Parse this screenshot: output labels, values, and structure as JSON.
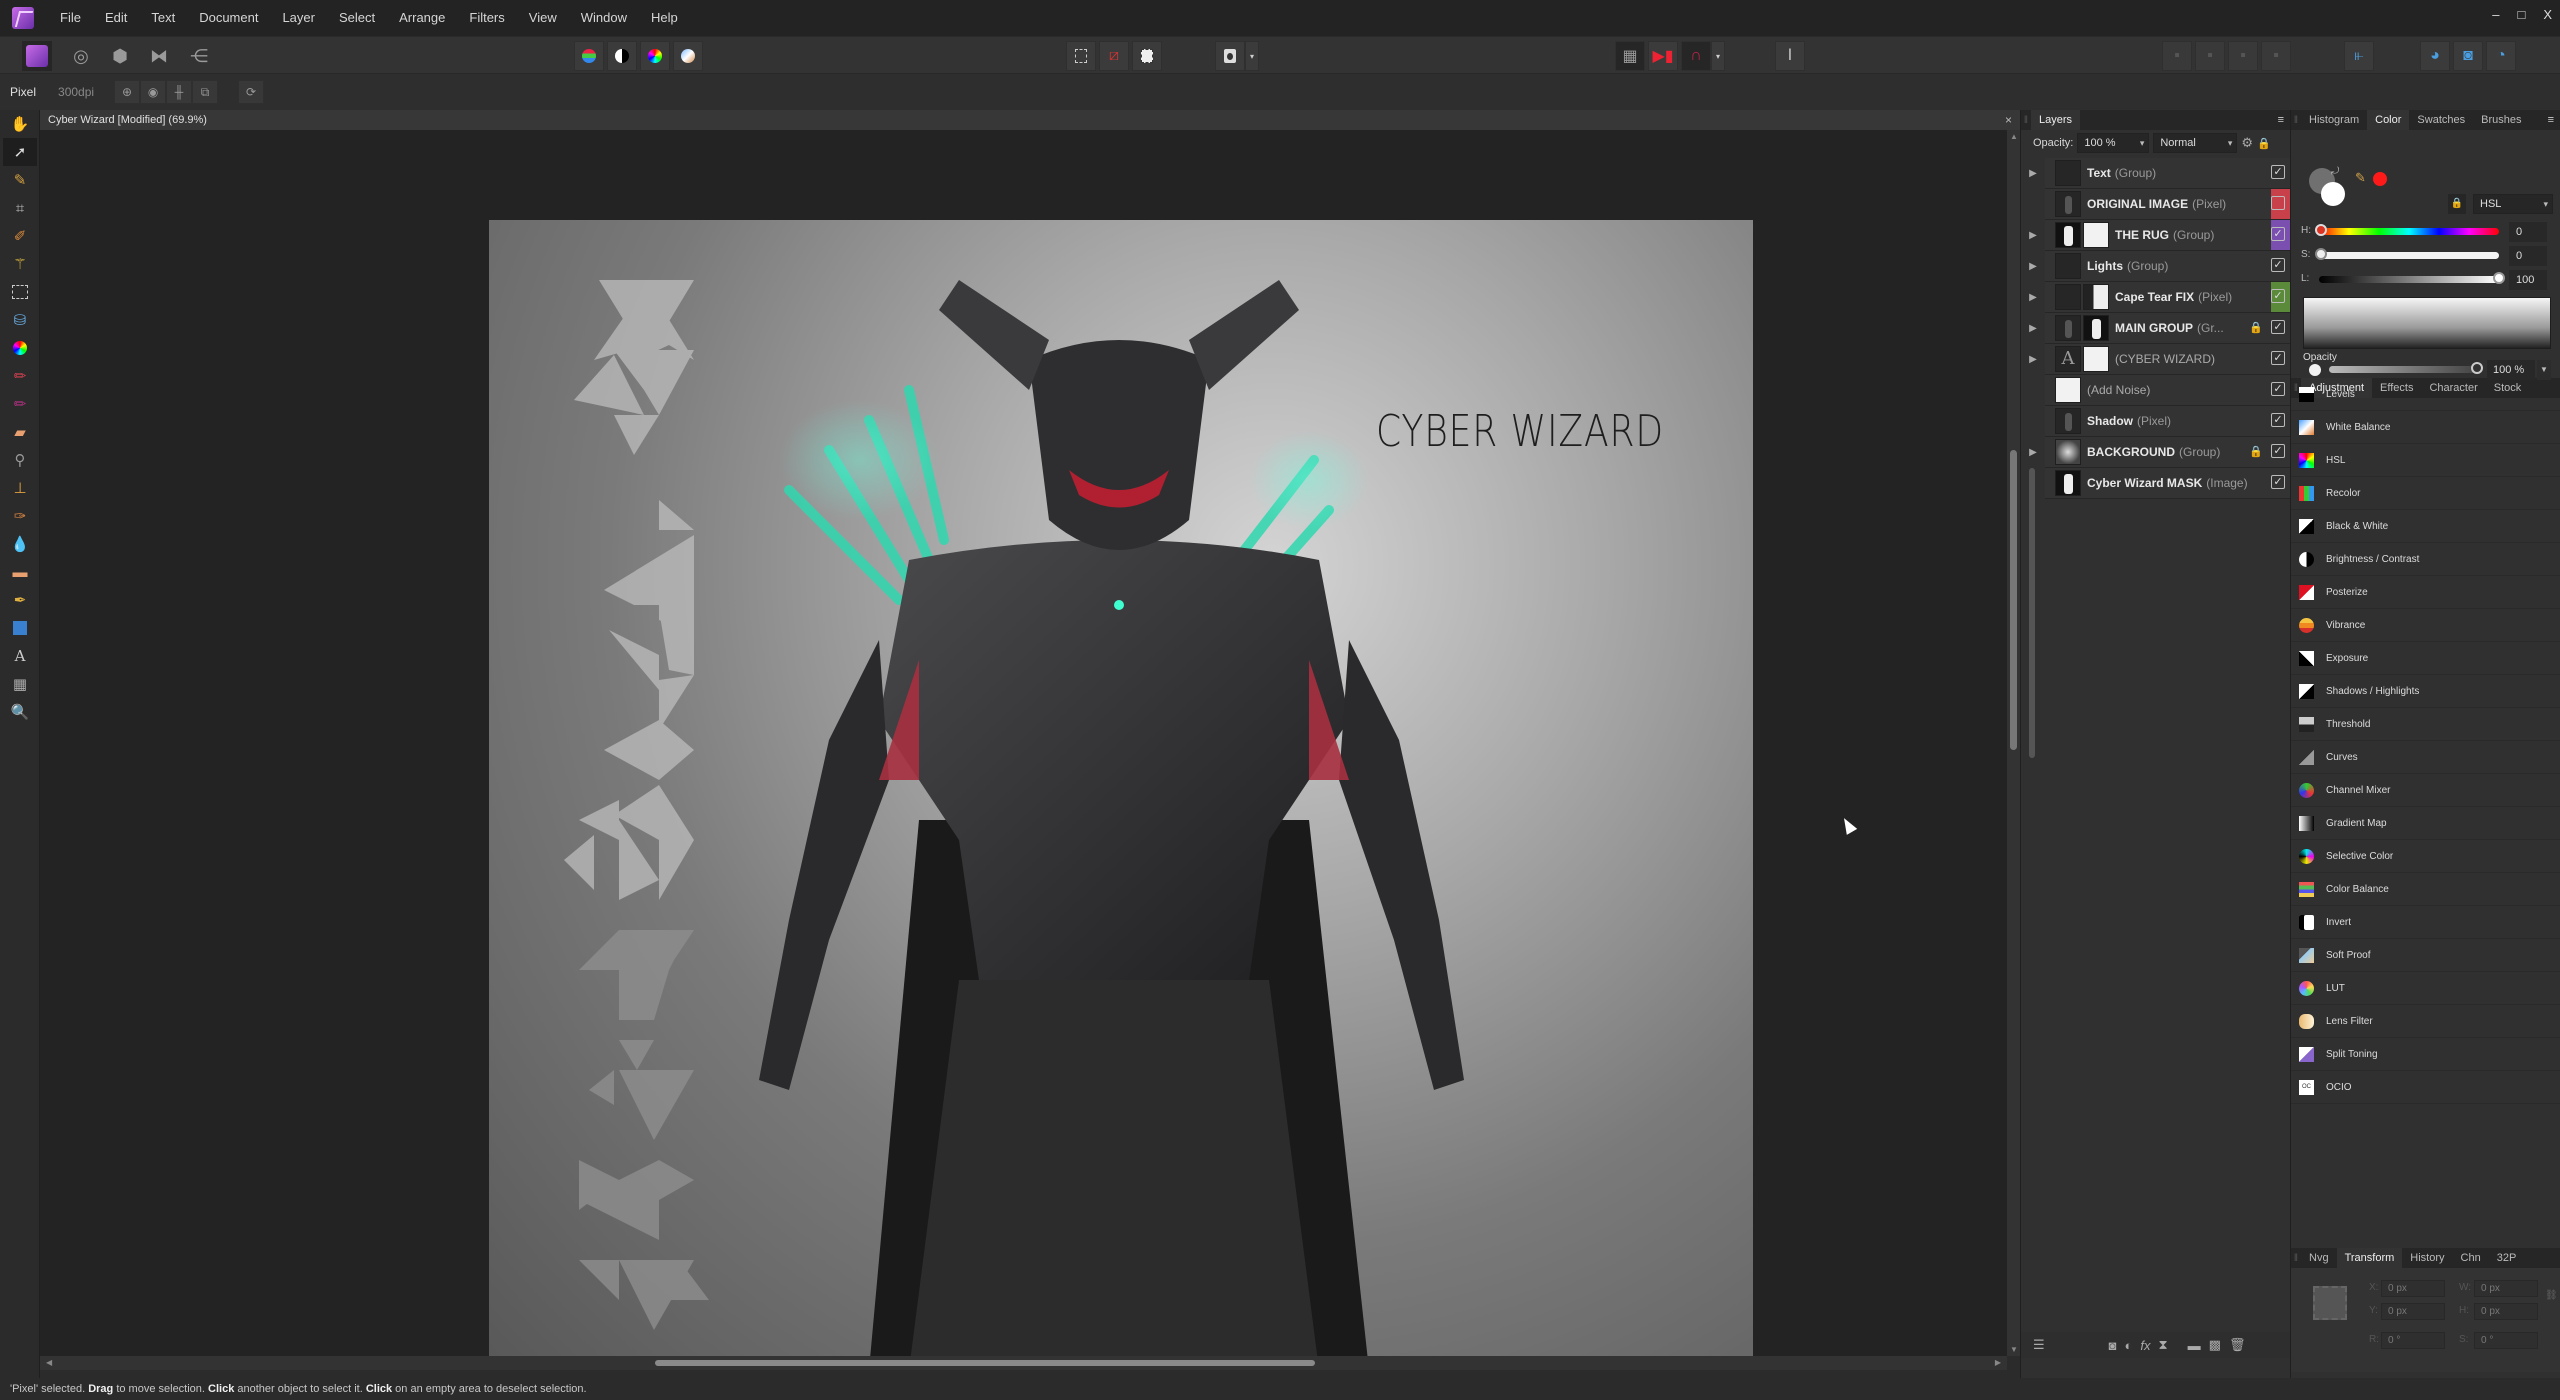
{
  "menubar": {
    "items": [
      "File",
      "Edit",
      "Text",
      "Document",
      "Layer",
      "Select",
      "Arrange",
      "Filters",
      "View",
      "Window",
      "Help"
    ],
    "window_controls": {
      "minimize": "–",
      "maximize": "□",
      "close": "X"
    }
  },
  "toolbar": {
    "personas": [
      "photo-persona",
      "liquify-persona",
      "develop-persona",
      "tone-mapping-persona",
      "export-persona"
    ],
    "quick_adjust": [
      "levels",
      "brightness-contrast",
      "hsl",
      "white-balance"
    ],
    "selection_tools": [
      "select-all",
      "deselect",
      "invert-selection"
    ],
    "mask_tool": "quick-mask",
    "snapping": [
      "grid",
      "assistant",
      "snapping-magnet"
    ]
  },
  "contextbar": {
    "layer_type": "Pixel",
    "dpi": "300dpi"
  },
  "document": {
    "tab_title": "Cyber Wizard [Modified] (69.9%)",
    "close": "×",
    "art_title": "CYBER WIZARD"
  },
  "status": {
    "prefix": "'Pixel' selected.",
    "b1": "Drag",
    "t1": " to move selection. ",
    "b2": "Click",
    "t2": " another object to select it. ",
    "b3": "Click",
    "t3": " on an empty area to deselect selection."
  },
  "layers": {
    "tab": "Layers",
    "opacity_label": "Opacity:",
    "opacity_value": "100 %",
    "blend_mode": "Normal",
    "rows": [
      {
        "name": "Text",
        "type": "(Group)",
        "expandable": true,
        "checked": true,
        "tag": "",
        "locked": false
      },
      {
        "name": "ORIGINAL IMAGE",
        "type": "(Pixel)",
        "expandable": false,
        "checked": false,
        "tag": "#c8414a",
        "locked": false
      },
      {
        "name": "THE RUG",
        "type": "(Group)",
        "expandable": true,
        "checked": true,
        "tag": "#7a4fb0",
        "locked": false
      },
      {
        "name": "Lights",
        "type": "(Group)",
        "expandable": true,
        "checked": true,
        "tag": "",
        "locked": false
      },
      {
        "name": "Cape Tear FIX",
        "type": "(Pixel)",
        "expandable": true,
        "checked": true,
        "tag": "#5a8a3a",
        "locked": false
      },
      {
        "name": "MAIN GROUP",
        "type": "(Gr...",
        "expandable": true,
        "checked": true,
        "tag": "",
        "locked": true
      },
      {
        "name": "(CYBER WIZARD)",
        "type": "",
        "expandable": true,
        "checked": true,
        "tag": "",
        "locked": false
      },
      {
        "name": "(Add Noise)",
        "type": "",
        "expandable": false,
        "checked": true,
        "tag": "",
        "locked": false
      },
      {
        "name": "Shadow",
        "type": "(Pixel)",
        "expandable": false,
        "checked": true,
        "tag": "",
        "locked": false
      },
      {
        "name": "BACKGROUND",
        "type": "(Group)",
        "expandable": true,
        "checked": true,
        "tag": "",
        "locked": true
      },
      {
        "name": "Cyber Wizard MASK",
        "type": "(Image)",
        "expandable": false,
        "checked": true,
        "tag": "",
        "locked": false
      }
    ]
  },
  "color_panel": {
    "tabs": [
      "Histogram",
      "Color",
      "Swatches",
      "Brushes"
    ],
    "active_tab": "Color",
    "model": "HSL",
    "h_label": "H:",
    "h_value": "0",
    "s_label": "S:",
    "s_value": "0",
    "l_label": "L:",
    "l_value": "100",
    "opacity_label": "Opacity",
    "opacity_value": "100 %",
    "accent_red": "#ff1a1a"
  },
  "adjustment_panel": {
    "tabs": [
      "Adjustment",
      "Effects",
      "Character",
      "Stock"
    ],
    "active_tab": "Adjustment",
    "items": [
      "Levels",
      "White Balance",
      "HSL",
      "Recolor",
      "Black & White",
      "Brightness / Contrast",
      "Posterize",
      "Vibrance",
      "Exposure",
      "Shadows / Highlights",
      "Threshold",
      "Curves",
      "Channel Mixer",
      "Gradient Map",
      "Selective Color",
      "Color Balance",
      "Invert",
      "Soft Proof",
      "LUT",
      "Lens Filter",
      "Split Toning",
      "OCIO"
    ]
  },
  "transform_panel": {
    "tabs": [
      "Nvg",
      "Transform",
      "History",
      "Chn",
      "32P"
    ],
    "active_tab": "Transform",
    "x": "0 px",
    "y": "0 px",
    "w": "0 px",
    "h": "0 px",
    "r": "0 °",
    "s": "0 °",
    "x_label": "X:",
    "y_label": "Y:",
    "w_label": "W:",
    "h_label": "H:",
    "r_label": "R:",
    "s_label": "S:"
  }
}
